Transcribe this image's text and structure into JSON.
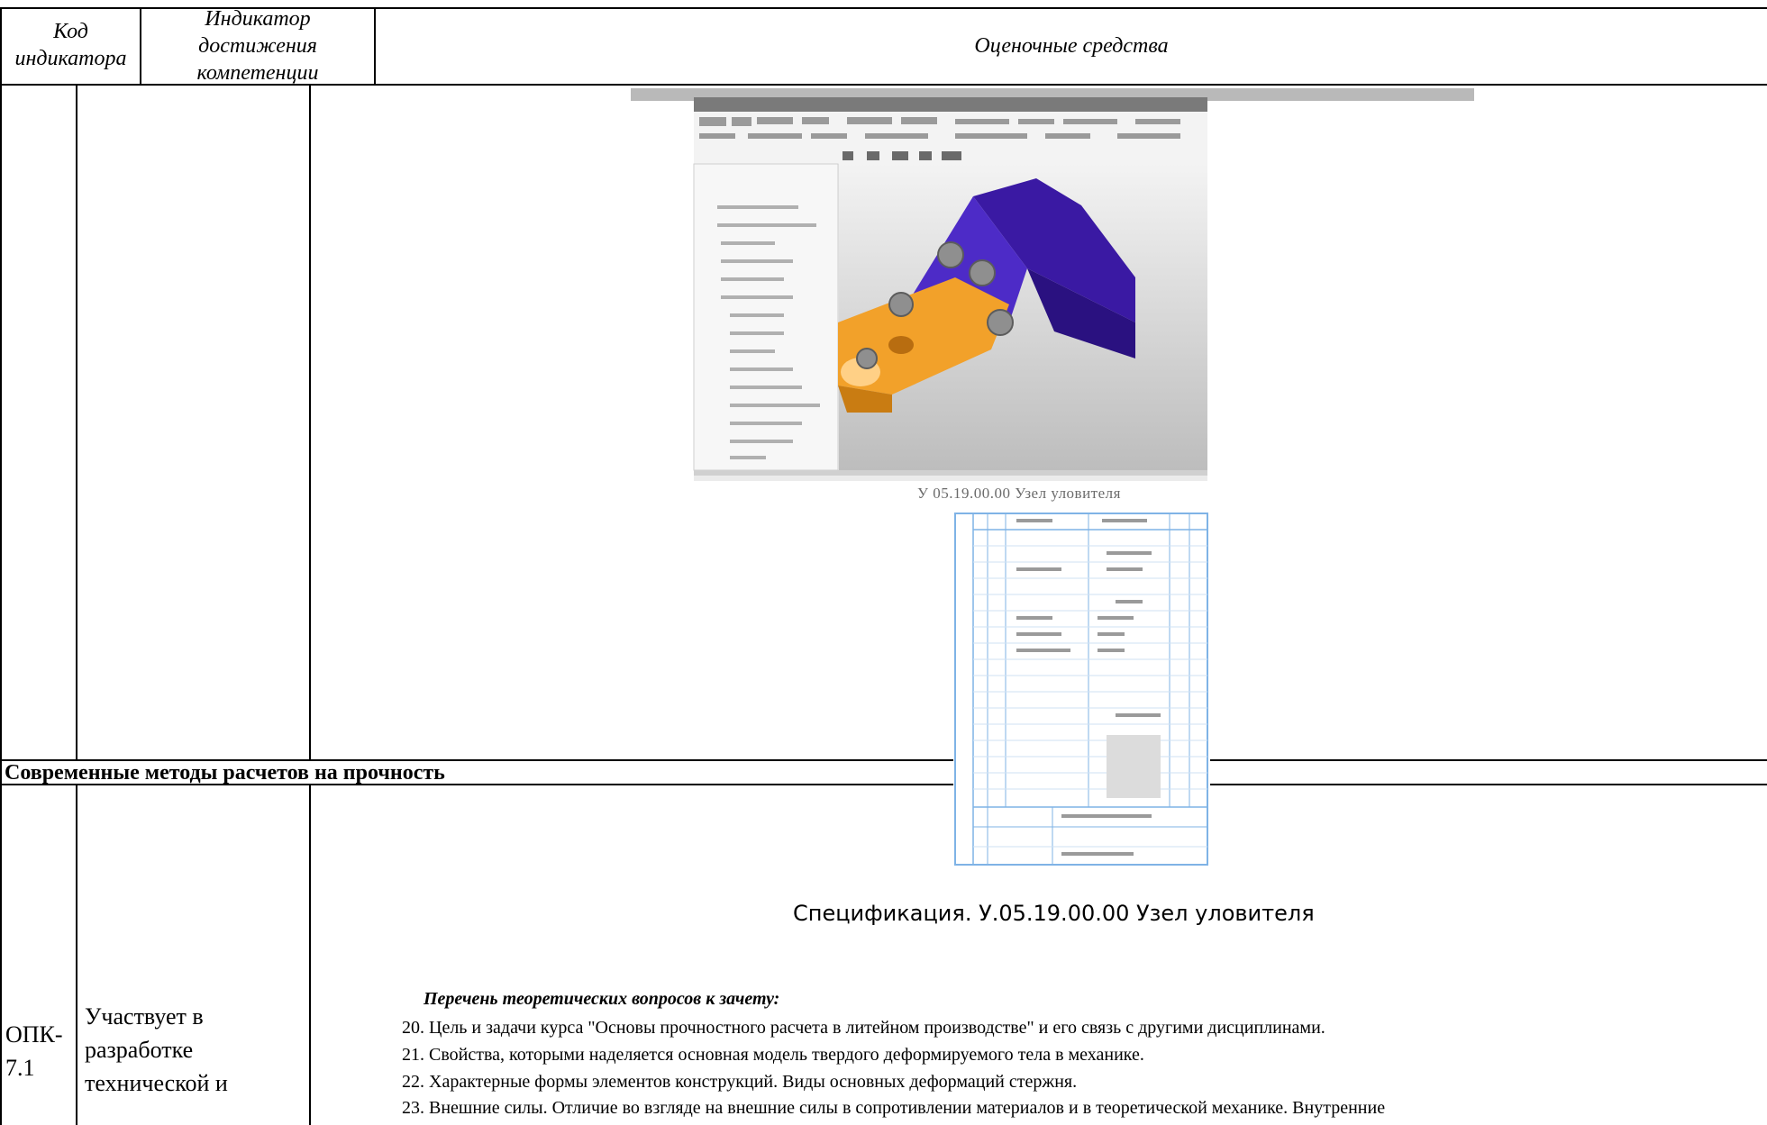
{
  "header": {
    "col1": "Код индикатора",
    "col1_l1": "Код",
    "col1_l2": "индикатора",
    "col2_l1": "Индикатор",
    "col2_l2": "достижения",
    "col2_l3": "компетенции",
    "col3": "Оценочные средства"
  },
  "figures": {
    "model_caption": "У 05.19.00.00 Узел уловителя",
    "spec_caption": "Спецификация. У.05.19.00.00 Узел уловителя"
  },
  "section": {
    "title": "Современные методы расчетов на прочность"
  },
  "row": {
    "code_l1": "ОПК-",
    "code_l2": "7.1",
    "indicator_l1": "Участвует в",
    "indicator_l2": "разработке",
    "indicator_l3": "технической и"
  },
  "questions": {
    "heading": "Перечень теоретических вопросов к зачету:",
    "items": [
      "20.  Цель и задачи курса \"Основы прочностного расчета в литейном производстве\" и его связь с другими дисциплинами.",
      "21.  Свойства, которыми наделяется основная модель твердого деформируемого тела в механике.",
      "22.  Характерные формы элементов конструкций. Виды основных деформаций стержня.",
      "23.  Внешние силы. Отличие во взгляде на внешние силы в сопротивлении материалов и в теоретической механике. Внутренние"
    ]
  }
}
